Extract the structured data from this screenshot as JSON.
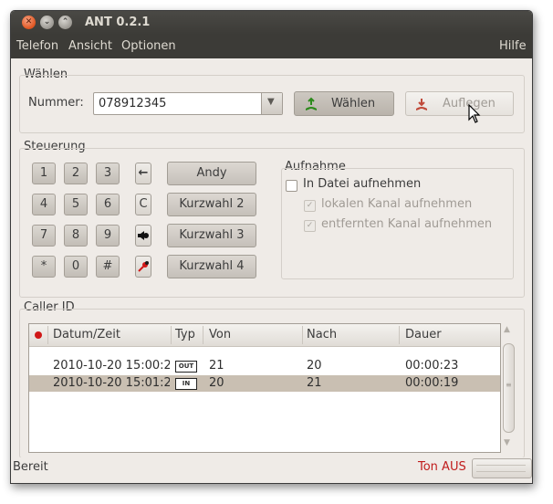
{
  "window": {
    "title": "ANT 0.2.1"
  },
  "menu": {
    "telefon": "Telefon",
    "ansicht": "Ansicht",
    "optionen": "Optionen",
    "hilfe": "Hilfe"
  },
  "dial": {
    "frame_label": "Wählen",
    "number_label": "Nummer:",
    "number_value": "078912345",
    "dial_button": "Wählen",
    "hangup_button": "Auflegen"
  },
  "control": {
    "frame_label": "Steuerung",
    "keys": [
      "1",
      "2",
      "3",
      "4",
      "5",
      "6",
      "7",
      "8",
      "9",
      "*",
      "0",
      "#"
    ],
    "clear_key": "C",
    "speed_dial": [
      "Andy",
      "Kurzwahl 2",
      "Kurzwahl 3",
      "Kurzwahl 4"
    ]
  },
  "recording": {
    "frame_label": "Aufnahme",
    "record_file": "In Datei aufnehmen",
    "record_local": "lokalen Kanal aufnehmen",
    "record_remote": "entfernten Kanal aufnehmen"
  },
  "caller_id": {
    "frame_label": "Caller ID",
    "columns": [
      "Datum/Zeit",
      "Typ",
      "Von",
      "Nach",
      "Dauer"
    ],
    "rows": [
      {
        "datetime": "2010-10-20 15:00:2",
        "type": "OUT",
        "from": "21",
        "to": "20",
        "duration": "00:00:23"
      },
      {
        "datetime": "2010-10-20 15:01:2",
        "type": "IN",
        "from": "20",
        "to": "21",
        "duration": "00:00:19"
      }
    ]
  },
  "status": {
    "text": "Bereit",
    "sound": "Ton AUS"
  },
  "colors": {
    "titlebar": "#3c3b37",
    "accent_red": "#c01c1c",
    "selected_row": "#c9bfb2"
  }
}
